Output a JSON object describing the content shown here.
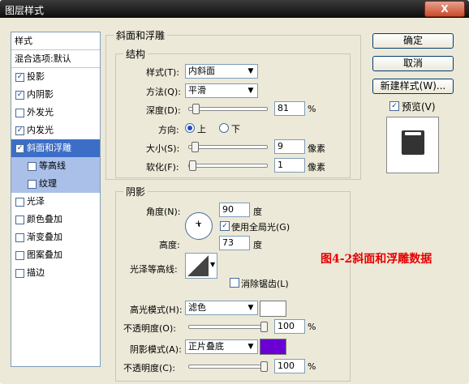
{
  "window": {
    "title": "图层样式",
    "close_label": "X"
  },
  "style_list": {
    "header": "样式",
    "blend": "混合选项:默认",
    "items": [
      {
        "label": "投影",
        "checked": true
      },
      {
        "label": "内阴影",
        "checked": true
      },
      {
        "label": "外发光",
        "checked": false
      },
      {
        "label": "内发光",
        "checked": true
      },
      {
        "label": "斜面和浮雕",
        "checked": true,
        "selected": true
      },
      {
        "label": "等高线",
        "checked": false,
        "sub": true
      },
      {
        "label": "纹理",
        "checked": false,
        "sub": true
      },
      {
        "label": "光泽",
        "checked": false
      },
      {
        "label": "颜色叠加",
        "checked": false
      },
      {
        "label": "渐变叠加",
        "checked": false
      },
      {
        "label": "图案叠加",
        "checked": false
      },
      {
        "label": "描边",
        "checked": false
      }
    ],
    "check_mark": "✓"
  },
  "bevel": {
    "group_title": "斜面和浮雕",
    "structure_title": "结构",
    "style_label": "样式(T):",
    "style_value": "内斜面",
    "technique_label": "方法(Q):",
    "technique_value": "平滑",
    "depth_label": "深度(D):",
    "depth_value": "81",
    "depth_unit": "%",
    "direction_label": "方向:",
    "dir_up": "上",
    "dir_down": "下",
    "size_label": "大小(S):",
    "size_value": "9",
    "size_unit": "像素",
    "soften_label": "软化(F):",
    "soften_value": "1",
    "soften_unit": "像素"
  },
  "shading": {
    "title": "阴影",
    "angle_label": "角度(N):",
    "angle_value": "90",
    "angle_unit": "度",
    "global_light_label": "使用全局光(G)",
    "altitude_label": "高度:",
    "altitude_value": "73",
    "altitude_unit": "度",
    "gloss_label": "光泽等高线:",
    "antialias_label": "消除锯齿(L)",
    "highlight_label": "高光模式(H):",
    "highlight_value": "滤色",
    "highlight_color": "#ffffff",
    "hi_opacity_label": "不透明度(O):",
    "hi_opacity_value": "100",
    "shadow_label": "阴影模式(A):",
    "shadow_value": "正片叠底",
    "shadow_color": "#6a00d4",
    "sh_opacity_label": "不透明度(C):",
    "sh_opacity_value": "100",
    "pct": "%"
  },
  "buttons": {
    "ok": "确定",
    "cancel": "取消",
    "new_style": "新建样式(W)...",
    "preview_label": "预览(V)"
  },
  "annotation": "图4-2斜面和浮雕数据",
  "sliders": {
    "depth": 0.05,
    "size": 0.03,
    "soften": 0.0,
    "hi_opacity": 1.0,
    "sh_opacity": 1.0
  }
}
